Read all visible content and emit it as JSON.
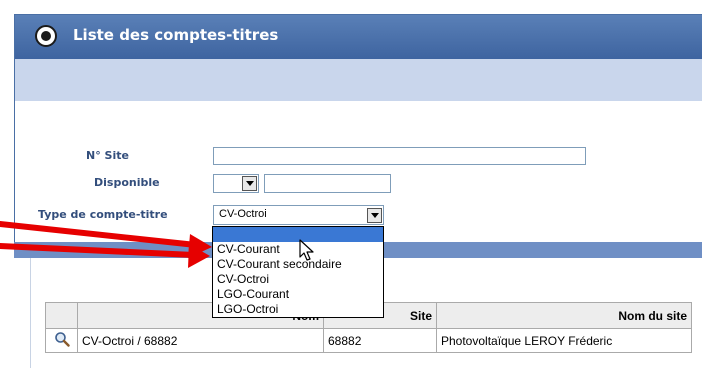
{
  "window": {
    "title": "Liste des comptes-titres"
  },
  "form": {
    "site_label": "N° Site",
    "site_value": "",
    "disponible_label": "Disponible",
    "disponible_value": "",
    "disponible_text": "",
    "type_label": "Type de compte-titre",
    "type_selected": "CV-Octroi"
  },
  "dropdown": {
    "options": [
      "",
      "CV-Courant",
      "CV-Courant secondaire",
      "CV-Octroi",
      "LGO-Courant",
      "LGO-Octroi"
    ],
    "highlighted_index": 0
  },
  "table": {
    "columns": [
      "",
      "Nom",
      "Site",
      "Nom du site"
    ],
    "rows": [
      {
        "icon": "magnifier-icon",
        "nom": "CV-Octroi / 68882",
        "site": "68882",
        "nom_site": "Photovoltaïque LEROY Fréderic"
      }
    ]
  },
  "colors": {
    "title_bar": "#4a70aa",
    "band": "#c9d6ec",
    "highlight": "#3a78d4",
    "annotation_arrow": "#e60000"
  }
}
